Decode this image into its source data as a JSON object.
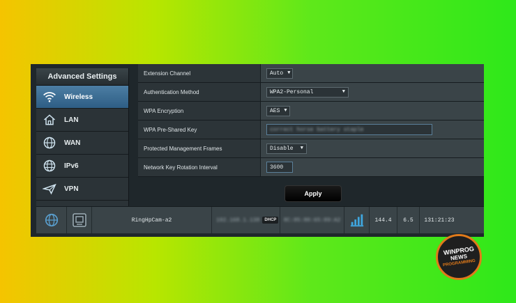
{
  "sidebar": {
    "title": "Advanced Settings",
    "items": [
      {
        "label": "Wireless",
        "icon": "wifi-icon",
        "active": true
      },
      {
        "label": "LAN",
        "icon": "home-icon",
        "active": false
      },
      {
        "label": "WAN",
        "icon": "globe-icon",
        "active": false
      },
      {
        "label": "IPv6",
        "icon": "ipv6-globe-icon",
        "active": false
      },
      {
        "label": "VPN",
        "icon": "vpn-plane-icon",
        "active": false
      }
    ]
  },
  "settings": {
    "rows": [
      {
        "label": "Extension Channel",
        "value": "Auto"
      },
      {
        "label": "Authentication Method",
        "value": "WPA2-Personal"
      },
      {
        "label": "WPA Encryption",
        "value": "AES"
      },
      {
        "label": "WPA Pre-Shared Key",
        "value": "correct horse battery staple"
      },
      {
        "label": "Protected Management Frames",
        "value": "Disable"
      },
      {
        "label": "Network Key Rotation Interval",
        "value": "3600"
      }
    ],
    "apply_label": "Apply"
  },
  "client": {
    "name": "RingHpCam-a2",
    "ip": "192.168.1.138",
    "ip_type": "DHCP",
    "mac": "8C:85:80:65:89:A2",
    "tx_rate": "144.4",
    "rx_rate": "6.5",
    "access_time": "131:21:23"
  },
  "logo": {
    "line1": "WINPROG",
    "line2": "NEWS",
    "line3": "PROGRAMMING"
  },
  "colors": {
    "accent": "#4c7ea3",
    "panel": "#2c3438",
    "logo_ring": "#e07a1a"
  }
}
